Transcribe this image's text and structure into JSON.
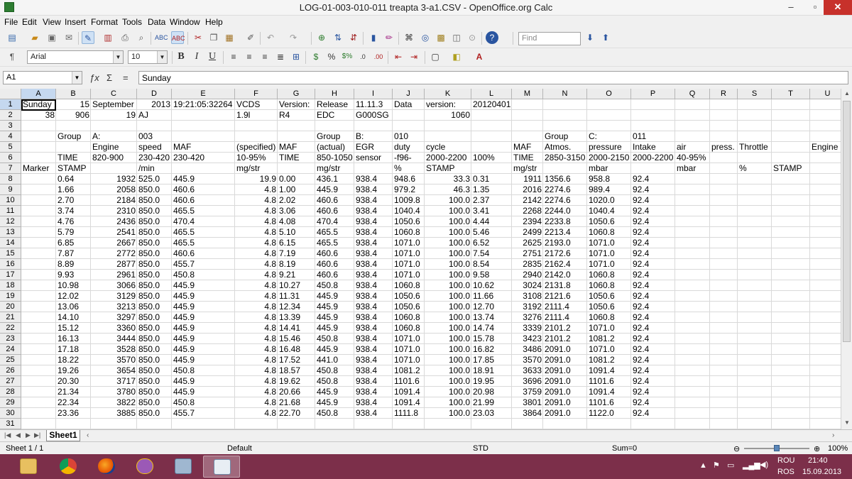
{
  "window": {
    "title": "LOG-01-003-010-011 treapta 3-a1.CSV - OpenOffice.org Calc",
    "min": "–",
    "max": "▫",
    "close": "✕"
  },
  "menu": [
    "File",
    "Edit",
    "View",
    "Insert",
    "Format",
    "Tools",
    "Data",
    "Window",
    "Help"
  ],
  "toolbar": {
    "find_placeholder": "Find",
    "font_name": "Arial",
    "font_size": "10",
    "bold": "B",
    "italic": "I",
    "underline": "U",
    "currency": "$",
    "percent": "%"
  },
  "formula_bar": {
    "cell_ref": "A1",
    "content": "Sunday",
    "fx": "ƒx",
    "sum": "Σ",
    "equals": "="
  },
  "columns": [
    "A",
    "B",
    "C",
    "D",
    "E",
    "F",
    "G",
    "H",
    "I",
    "J",
    "K",
    "L",
    "M",
    "N",
    "O",
    "P",
    "Q",
    "R",
    "S",
    "T",
    "U"
  ],
  "rows": [
    "1",
    "2",
    "3",
    "4",
    "5",
    "6",
    "7",
    "8",
    "9",
    "10",
    "11",
    "12",
    "13",
    "14",
    "15",
    "16",
    "17",
    "18",
    "19",
    "20",
    "21",
    "22",
    "23",
    "24",
    "25",
    "26",
    "27",
    "28",
    "29",
    "30",
    "31"
  ],
  "header_cells": [
    [
      [
        0,
        "Sunday",
        0
      ],
      [
        1,
        "15",
        1
      ],
      [
        2,
        "September",
        0
      ],
      [
        3,
        "2013",
        1
      ],
      [
        4,
        "19:21:05:32264",
        0
      ],
      [
        5,
        "VCDS",
        0
      ],
      [
        6,
        "Version:",
        0
      ],
      [
        7,
        "Release",
        0
      ],
      [
        8,
        "11.11.3",
        0
      ],
      [
        9,
        "Data",
        0
      ],
      [
        10,
        "version:",
        0
      ],
      [
        11,
        "20120401",
        0
      ]
    ],
    [
      [
        0,
        "38",
        1
      ],
      [
        1,
        "906",
        1
      ],
      [
        2,
        "19",
        1
      ],
      [
        3,
        "AJ",
        0
      ],
      [
        5,
        "1.9l",
        0
      ],
      [
        6,
        "R4",
        0
      ],
      [
        7,
        "EDC",
        0
      ],
      [
        8,
        "G000SG",
        0
      ],
      [
        10,
        "1060",
        1
      ]
    ],
    [],
    [
      [
        1,
        "Group",
        0
      ],
      [
        2,
        "A:",
        0
      ],
      [
        3,
        "003",
        0
      ],
      [
        7,
        "Group",
        0
      ],
      [
        8,
        "B:",
        0
      ],
      [
        9,
        "010",
        0
      ],
      [
        13,
        "Group",
        0
      ],
      [
        14,
        "C:",
        0
      ],
      [
        15,
        "011",
        0
      ]
    ],
    [
      [
        2,
        "Engine",
        0
      ],
      [
        3,
        "speed",
        0
      ],
      [
        4,
        "MAF",
        0
      ],
      [
        5,
        "(specified)",
        0
      ],
      [
        6,
        "MAF",
        0
      ],
      [
        7,
        "(actual)",
        0
      ],
      [
        8,
        "EGR",
        0
      ],
      [
        9,
        "duty",
        0
      ],
      [
        10,
        "cycle",
        0
      ],
      [
        12,
        "MAF",
        0
      ],
      [
        13,
        "Atmos.",
        0
      ],
      [
        14,
        "pressure",
        0
      ],
      [
        15,
        "Intake",
        0
      ],
      [
        16,
        "air",
        0
      ],
      [
        17,
        "press.",
        0
      ],
      [
        18,
        "Throttle",
        0
      ],
      [
        20,
        "Engine",
        0
      ]
    ],
    [
      [
        1,
        "TIME",
        0
      ],
      [
        2,
        "820-900",
        0
      ],
      [
        3,
        "230-420",
        0
      ],
      [
        4,
        "230-420",
        0
      ],
      [
        5,
        "10-95%",
        0
      ],
      [
        6,
        "TIME",
        0
      ],
      [
        7,
        "850-1050",
        0
      ],
      [
        8,
        "sensor",
        0
      ],
      [
        9,
        "-f96-",
        0
      ],
      [
        10,
        "2000-2200",
        0
      ],
      [
        11,
        "100%",
        0
      ],
      [
        12,
        "TIME",
        0
      ],
      [
        13,
        "2850-3150",
        0
      ],
      [
        14,
        "2000-2150",
        0
      ],
      [
        15,
        "2000-2200",
        0
      ],
      [
        16,
        "40-95%",
        0
      ]
    ],
    [
      [
        0,
        "Marker",
        0
      ],
      [
        1,
        "STAMP",
        0
      ],
      [
        3,
        "/min",
        0
      ],
      [
        5,
        "mg/str",
        0
      ],
      [
        7,
        "mg/str",
        0
      ],
      [
        9,
        "%",
        0
      ],
      [
        10,
        "STAMP",
        0
      ],
      [
        12,
        "mg/str",
        0
      ],
      [
        14,
        "mbar",
        0
      ],
      [
        16,
        "mbar",
        0
      ],
      [
        18,
        "%",
        0
      ],
      [
        19,
        "STAMP",
        0
      ]
    ]
  ],
  "data_rows": [
    [
      "0.64",
      "1932",
      "525.0",
      "445.9",
      "19.9",
      "0.00",
      "436.1",
      "938.4",
      "948.6",
      "33.3",
      "0.31",
      "1911",
      "1356.6",
      "958.8",
      "92.4"
    ],
    [
      "1.66",
      "2058",
      "850.0",
      "460.6",
      "4.8",
      "1.00",
      "445.9",
      "938.4",
      "979.2",
      "46.3",
      "1.35",
      "2016",
      "2274.6",
      "989.4",
      "92.4"
    ],
    [
      "2.70",
      "2184",
      "850.0",
      "460.6",
      "4.8",
      "2.02",
      "460.6",
      "938.4",
      "1009.8",
      "100.0",
      "2.37",
      "2142",
      "2274.6",
      "1020.0",
      "92.4"
    ],
    [
      "3.74",
      "2310",
      "850.0",
      "465.5",
      "4.8",
      "3.06",
      "460.6",
      "938.4",
      "1040.4",
      "100.0",
      "3.41",
      "2268",
      "2244.0",
      "1040.4",
      "92.4"
    ],
    [
      "4.76",
      "2436",
      "850.0",
      "470.4",
      "4.8",
      "4.08",
      "470.4",
      "938.4",
      "1050.6",
      "100.0",
      "4.44",
      "2394",
      "2233.8",
      "1050.6",
      "92.4"
    ],
    [
      "5.79",
      "2541",
      "850.0",
      "465.5",
      "4.8",
      "5.10",
      "465.5",
      "938.4",
      "1060.8",
      "100.0",
      "5.46",
      "2499",
      "2213.4",
      "1060.8",
      "92.4"
    ],
    [
      "6.85",
      "2667",
      "850.0",
      "465.5",
      "4.8",
      "6.15",
      "465.5",
      "938.4",
      "1071.0",
      "100.0",
      "6.52",
      "2625",
      "2193.0",
      "1071.0",
      "92.4"
    ],
    [
      "7.87",
      "2772",
      "850.0",
      "460.6",
      "4.8",
      "7.19",
      "460.6",
      "938.4",
      "1071.0",
      "100.0",
      "7.54",
      "2751",
      "2172.6",
      "1071.0",
      "92.4"
    ],
    [
      "8.89",
      "2877",
      "850.0",
      "455.7",
      "4.8",
      "8.19",
      "460.6",
      "938.4",
      "1071.0",
      "100.0",
      "8.54",
      "2835",
      "2162.4",
      "1071.0",
      "92.4"
    ],
    [
      "9.93",
      "2961",
      "850.0",
      "450.8",
      "4.8",
      "9.21",
      "460.6",
      "938.4",
      "1071.0",
      "100.0",
      "9.58",
      "2940",
      "2142.0",
      "1060.8",
      "92.4"
    ],
    [
      "10.98",
      "3066",
      "850.0",
      "445.9",
      "4.8",
      "10.27",
      "450.8",
      "938.4",
      "1060.8",
      "100.0",
      "10.62",
      "3024",
      "2131.8",
      "1060.8",
      "92.4"
    ],
    [
      "12.02",
      "3129",
      "850.0",
      "445.9",
      "4.8",
      "11.31",
      "445.9",
      "938.4",
      "1050.6",
      "100.0",
      "11.66",
      "3108",
      "2121.6",
      "1050.6",
      "92.4"
    ],
    [
      "13.06",
      "3213",
      "850.0",
      "445.9",
      "4.8",
      "12.34",
      "445.9",
      "938.4",
      "1050.6",
      "100.0",
      "12.70",
      "3192",
      "2111.4",
      "1050.6",
      "92.4"
    ],
    [
      "14.10",
      "3297",
      "850.0",
      "445.9",
      "4.8",
      "13.39",
      "445.9",
      "938.4",
      "1060.8",
      "100.0",
      "13.74",
      "3276",
      "2111.4",
      "1060.8",
      "92.4"
    ],
    [
      "15.12",
      "3360",
      "850.0",
      "445.9",
      "4.8",
      "14.41",
      "445.9",
      "938.4",
      "1060.8",
      "100.0",
      "14.74",
      "3339",
      "2101.2",
      "1071.0",
      "92.4"
    ],
    [
      "16.13",
      "3444",
      "850.0",
      "445.9",
      "4.8",
      "15.46",
      "450.8",
      "938.4",
      "1071.0",
      "100.0",
      "15.78",
      "3423",
      "2101.2",
      "1081.2",
      "92.4"
    ],
    [
      "17.18",
      "3528",
      "850.0",
      "445.9",
      "4.8",
      "16.48",
      "445.9",
      "938.4",
      "1071.0",
      "100.0",
      "16.82",
      "3486",
      "2091.0",
      "1071.0",
      "92.4"
    ],
    [
      "18.22",
      "3570",
      "850.0",
      "445.9",
      "4.8",
      "17.52",
      "441.0",
      "938.4",
      "1071.0",
      "100.0",
      "17.85",
      "3570",
      "2091.0",
      "1081.2",
      "92.4"
    ],
    [
      "19.26",
      "3654",
      "850.0",
      "450.8",
      "4.8",
      "18.57",
      "450.8",
      "938.4",
      "1081.2",
      "100.0",
      "18.91",
      "3633",
      "2091.0",
      "1091.4",
      "92.4"
    ],
    [
      "20.30",
      "3717",
      "850.0",
      "445.9",
      "4.8",
      "19.62",
      "450.8",
      "938.4",
      "1101.6",
      "100.0",
      "19.95",
      "3696",
      "2091.0",
      "1101.6",
      "92.4"
    ],
    [
      "21.34",
      "3780",
      "850.0",
      "445.9",
      "4.8",
      "20.66",
      "445.9",
      "938.4",
      "1091.4",
      "100.0",
      "20.98",
      "3759",
      "2091.0",
      "1091.4",
      "92.4"
    ],
    [
      "22.34",
      "3822",
      "850.0",
      "450.8",
      "4.8",
      "21.68",
      "445.9",
      "938.4",
      "1091.4",
      "100.0",
      "21.99",
      "3801",
      "2091.0",
      "1101.6",
      "92.4"
    ],
    [
      "23.36",
      "3885",
      "850.0",
      "455.7",
      "4.8",
      "22.70",
      "450.8",
      "938.4",
      "1111.8",
      "100.0",
      "23.03",
      "3864",
      "2091.0",
      "1122.0",
      "92.4"
    ]
  ],
  "sheet_tab": "Sheet1",
  "status": {
    "sheet": "Sheet 1 / 1",
    "style": "Default",
    "mode": "STD",
    "sum": "Sum=0",
    "zoom": "100%",
    "zoom_level_percent": 100
  },
  "taskbar": {
    "lang_top": "ROU",
    "lang_bottom": "ROS",
    "time": "21:40",
    "date": "15.09.2013"
  }
}
